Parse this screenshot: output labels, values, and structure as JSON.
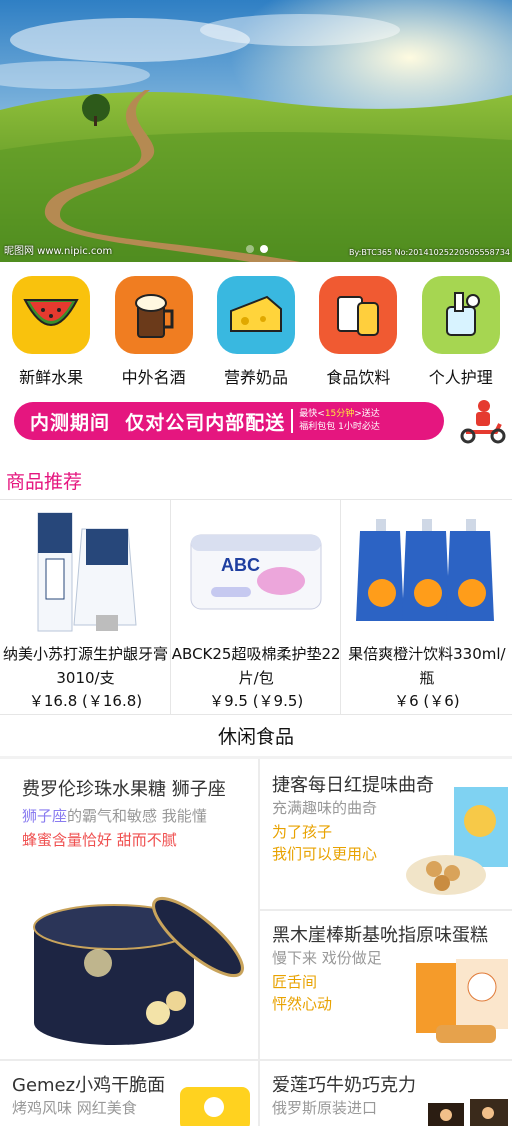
{
  "banner": {
    "watermark_left": "昵图网 www.nipic.com",
    "watermark_right": "By:BTC365 No:20141025220505558734",
    "dots": 2,
    "active_dot": 1
  },
  "categories": [
    {
      "label": "新鲜水果",
      "icon": "watermelon-icon",
      "color": "#f9c20d"
    },
    {
      "label": "中外名酒",
      "icon": "beer-mug-icon",
      "color": "#f07d21"
    },
    {
      "label": "营养奶品",
      "icon": "cheese-icon",
      "color": "#39b8e0"
    },
    {
      "label": "食品饮料",
      "icon": "snacks-drink-icon",
      "color": "#f05a32"
    },
    {
      "label": "个人护理",
      "icon": "toothpaste-icon",
      "color": "#a6d651"
    }
  ],
  "promo": {
    "main_a": "内测期间",
    "main_b": "仅对公司内部配送",
    "line1_a": "最快<",
    "line1_hl": "15分钟",
    "line1_b": ">送达",
    "line2": "福利包包 1小时必达"
  },
  "section_title": "商品推荐",
  "recommend": [
    {
      "name": "纳美小苏打源生护龈牙膏3010/支",
      "price": "￥16.8 (￥16.8)"
    },
    {
      "name": "ABCK25超吸棉柔护垫22片/包",
      "price": "￥9.5 (￥9.5)"
    },
    {
      "name": "果倍爽橙汁饮料330ml/瓶",
      "price": "￥6 (￥6)"
    }
  ],
  "leisure": {
    "title": "休闲食品",
    "items": [
      {
        "title": "费罗伦珍珠水果糖 狮子座",
        "lines": [
          "狮子座的霸气和敏感 我能懂",
          "蜂蜜含量恰好 甜而不腻"
        ]
      },
      {
        "title": "捷客每日红提味曲奇",
        "lines": [
          "充满趣味的曲奇",
          "为了孩子",
          "我们可以更用心"
        ]
      },
      {
        "title": "黑木崖棒斯基吮指原味蛋糕",
        "lines": [
          "慢下来 戏份做足",
          "匠舌间",
          "怦然心动"
        ]
      },
      {
        "title": "Gemez小鸡干脆面",
        "lines": [
          "烤鸡风味 网红美食"
        ]
      },
      {
        "title": "爱莲巧牛奶巧克力",
        "lines": [
          "俄罗斯原装进口"
        ]
      }
    ]
  },
  "colors": {
    "accent": "#e5167f",
    "orange_text": "#e8a200",
    "red_text": "#ef4f4f"
  }
}
